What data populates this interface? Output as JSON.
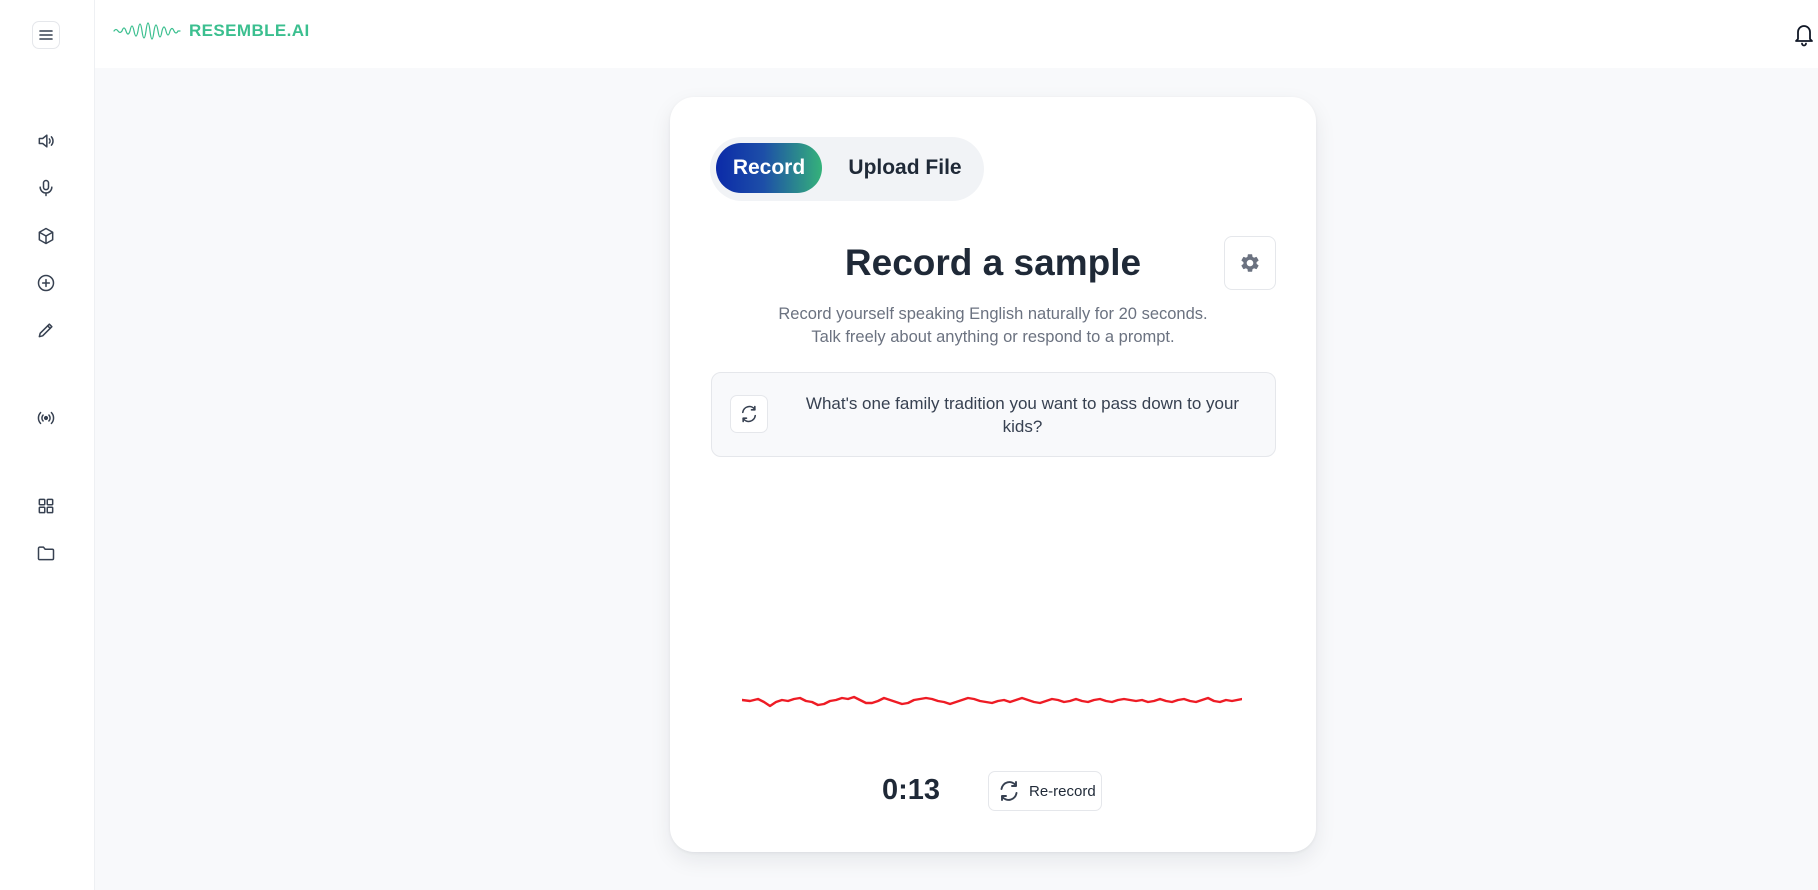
{
  "app": {
    "brand": "RESEMBLE.AI"
  },
  "sidebar": {
    "items": [
      {
        "icon": "speaker-icon"
      },
      {
        "icon": "microphone-icon"
      },
      {
        "icon": "cube-icon"
      },
      {
        "icon": "plus-circle-icon"
      },
      {
        "icon": "pencil-icon"
      },
      {
        "icon": "broadcast-icon"
      },
      {
        "icon": "grid-icon"
      },
      {
        "icon": "folder-icon"
      }
    ]
  },
  "tabs": {
    "record": "Record",
    "upload": "Upload File",
    "active": "Record"
  },
  "main": {
    "title": "Record a sample",
    "subtitle_line1": "Record yourself speaking English naturally for 20 seconds.",
    "subtitle_line2": "Talk freely about anything or respond to a prompt.",
    "prompt": "What's one family tradition you want to pass down to your kids?",
    "timer": "0:13",
    "rerecord_label": "Re-record"
  },
  "colors": {
    "accent_start": "#0b2aa8",
    "accent_end": "#35b27a",
    "brand": "#3bbf8f",
    "waveform": "#ee1c25"
  }
}
